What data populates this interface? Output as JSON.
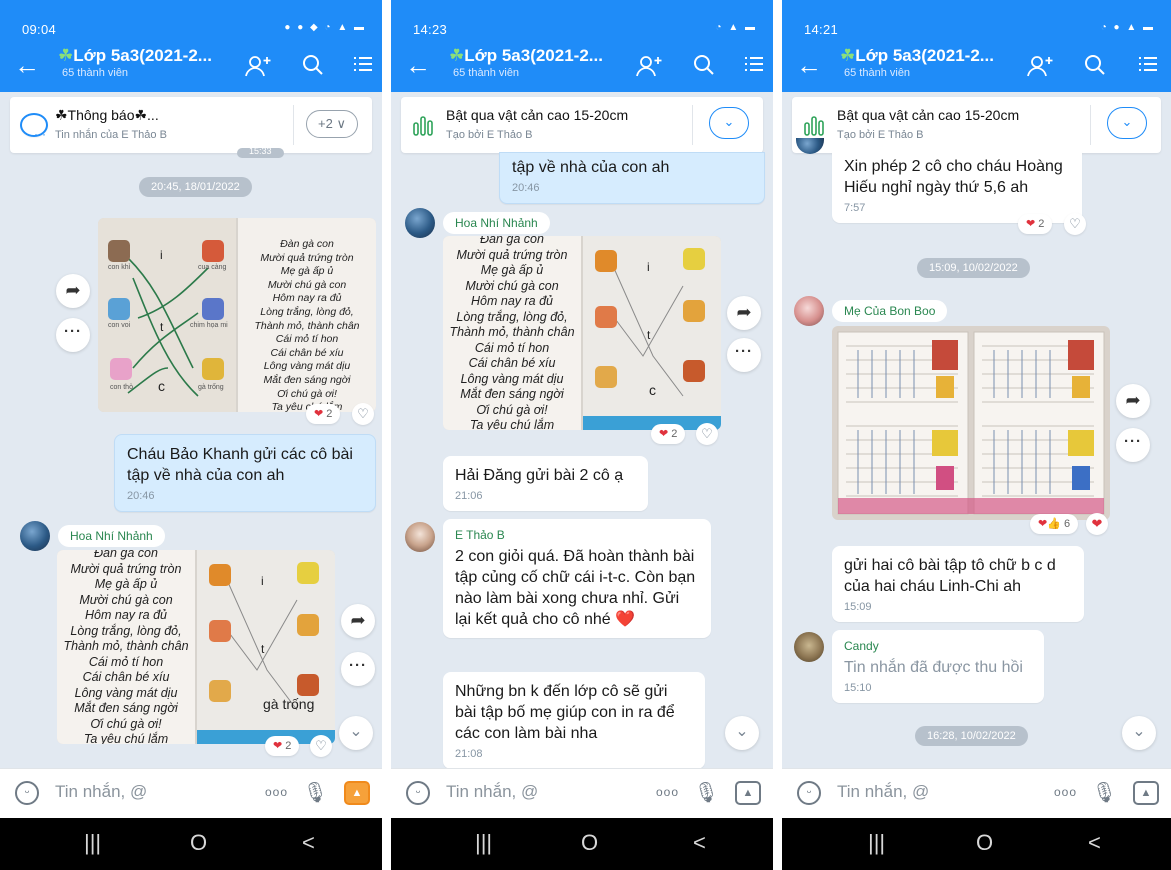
{
  "shared": {
    "group_title": "Lớp 5a3(2021-2...",
    "members": "65 thành viên",
    "input_placeholder": "Tin nhắn, @",
    "nav": {
      "recents": "|||",
      "home": "O",
      "back": "<"
    },
    "icons": {
      "back": "←",
      "add_member": "add-member-icon",
      "search": "search-icon",
      "menu": "menu-icon",
      "leaf": "leaf-icon"
    }
  },
  "screen1": {
    "status_time": "09:04",
    "pinned": {
      "title": "☘Thông báo☘...",
      "subtitle": "Tin nhắn của E Thảo B",
      "more": "+2 ∨"
    },
    "date1": "20:45, 18/01/2022",
    "partial_time": "15:33",
    "react1": "2",
    "msg1": {
      "text": "Cháu Bảo Khanh gửi các cô bài tập về nhà của con ah",
      "time": "20:46"
    },
    "sender_hoa": "Hoa Nhí Nhảnh",
    "react2": "2"
  },
  "screen2": {
    "status_time": "14:23",
    "pinned": {
      "title": "Bật qua vật cản cao 15-20cm",
      "subtitle": "Tạo bởi E Thảo B"
    },
    "msg_top": {
      "text": "tập về nhà của con ah",
      "time": "20:46"
    },
    "sender_hoa": "Hoa Nhí Nhảnh",
    "react1": "2",
    "msg_hai": {
      "text": "Hải Đăng gửi bài 2 cô ạ",
      "time": "21:06"
    },
    "msg_thao": {
      "sender": "E Thảo B",
      "text": "2 con giỏi quá. Đã hoàn thành bài tập củng cố chữ cái i-t-c. Còn bạn nào làm bài xong chưa nhỉ. Gửi lại kết quả cho cô nhé ❤️"
    },
    "msg_nhung": {
      "text": "Những bn k đến lớp cô sẽ gửi bài tập bố mẹ giúp con in ra để các con làm bài nha",
      "time": "21:08"
    }
  },
  "screen3": {
    "status_time": "14:21",
    "pinned": {
      "title": "Bật qua vật cản cao 15-20cm",
      "subtitle": "Tạo bởi E Thảo B"
    },
    "msg_top": {
      "text": "Xin phép 2 cô cho cháu Hoàng Hiếu nghỉ ngày thứ 5,6 ah",
      "time": "7:57"
    },
    "react1": "2",
    "date1": "15:09, 10/02/2022",
    "sender_boo": "Mẹ Của Bon Boo",
    "react2": "6",
    "msg_linh": {
      "text": "gửi hai cô bài tập tô chữ b c d của hai cháu Linh-Chi ah",
      "time": "15:09"
    },
    "msg_candy": {
      "sender": "Candy",
      "text": "Tin nhắn đã được thu hồi",
      "time": "15:10"
    },
    "date2": "16:28, 10/02/2022"
  },
  "poem": [
    "Đàn gà con",
    "Mười quả trứng tròn",
    "Mẹ gà ấp ủ",
    "Mười chú gà con",
    "Hôm nay ra đủ",
    "Lòng trắng, lòng đỏ,",
    "Thành mỏ, thành chân",
    "Cái mỏ tí hon",
    "Cái chân bé xíu",
    "Lông vàng mát dịu",
    "Mắt đen sáng ngời",
    "Ơi chú gà ơi!",
    "Ta yêu chú lắm"
  ],
  "worksheet": {
    "letters": [
      "i",
      "t",
      "c"
    ],
    "labels": [
      "con khỉ",
      "cua càng",
      "con voi",
      "chim họa mi",
      "con thỏ",
      "gà trống"
    ]
  },
  "colors": {
    "accent": "#1f8cf8",
    "bg": "#e2e9f1",
    "me_bubble": "#d6ecfe",
    "heart": "#e0323d",
    "sender": "#2a8750"
  }
}
